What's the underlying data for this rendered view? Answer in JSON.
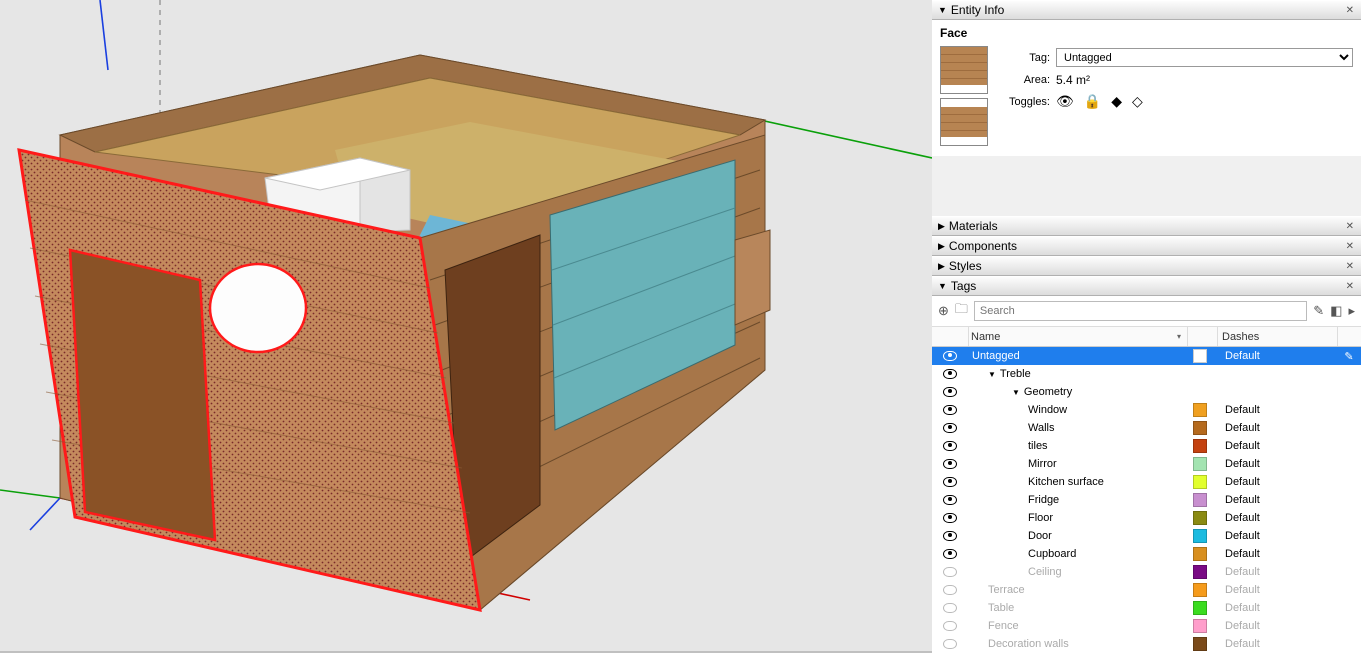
{
  "panels": {
    "entityInfo": {
      "title": "Entity Info",
      "selectionType": "Face",
      "tagLabel": "Tag:",
      "tagValue": "Untagged",
      "areaLabel": "Area:",
      "areaValue": "5.4 m²",
      "togglesLabel": "Toggles:"
    },
    "materials": {
      "title": "Materials"
    },
    "components": {
      "title": "Components"
    },
    "styles": {
      "title": "Styles"
    },
    "tags": {
      "title": "Tags",
      "searchPlaceholder": "Search",
      "columns": {
        "name": "Name",
        "dashes": "Dashes"
      },
      "rows": [
        {
          "vis": true,
          "name": "Untagged",
          "indent": 0,
          "tri": "",
          "swatch": "#ffffff",
          "dash": "Default",
          "selected": true,
          "pencil": true
        },
        {
          "vis": true,
          "name": "Treble",
          "indent": 1,
          "tri": "▼",
          "swatch": "",
          "dash": "",
          "selected": false
        },
        {
          "vis": true,
          "name": "Geometry",
          "indent": 2,
          "tri": "▼",
          "swatch": "",
          "dash": "",
          "selected": false
        },
        {
          "vis": true,
          "name": "Window",
          "indent": 3,
          "tri": "",
          "swatch": "#f0a020",
          "dash": "Default",
          "selected": false
        },
        {
          "vis": true,
          "name": "Walls",
          "indent": 3,
          "tri": "",
          "swatch": "#b56a1e",
          "dash": "Default",
          "selected": false
        },
        {
          "vis": true,
          "name": "tiles",
          "indent": 3,
          "tri": "",
          "swatch": "#c44210",
          "dash": "Default",
          "selected": false
        },
        {
          "vis": true,
          "name": "Mirror",
          "indent": 3,
          "tri": "",
          "swatch": "#a3e4b1",
          "dash": "Default",
          "selected": false
        },
        {
          "vis": true,
          "name": "Kitchen surface",
          "indent": 3,
          "tri": "",
          "swatch": "#e2ff2e",
          "dash": "Default",
          "selected": false
        },
        {
          "vis": true,
          "name": "Fridge",
          "indent": 3,
          "tri": "",
          "swatch": "#c88fcf",
          "dash": "Default",
          "selected": false
        },
        {
          "vis": true,
          "name": "Floor",
          "indent": 3,
          "tri": "",
          "swatch": "#8a8a12",
          "dash": "Default",
          "selected": false
        },
        {
          "vis": true,
          "name": "Door",
          "indent": 3,
          "tri": "",
          "swatch": "#1cbbe0",
          "dash": "Default",
          "selected": false
        },
        {
          "vis": true,
          "name": "Cupboard",
          "indent": 3,
          "tri": "",
          "swatch": "#d88f1f",
          "dash": "Default",
          "selected": false
        },
        {
          "vis": false,
          "name": "Ceiling",
          "indent": 3,
          "tri": "",
          "swatch": "#7a0b85",
          "dash": "Default",
          "selected": false
        },
        {
          "vis": false,
          "name": "Terrace",
          "indent": 1,
          "tri": "",
          "swatch": "#f59b1c",
          "dash": "Default",
          "selected": false
        },
        {
          "vis": false,
          "name": "Table",
          "indent": 1,
          "tri": "",
          "swatch": "#3bdc20",
          "dash": "Default",
          "selected": false
        },
        {
          "vis": false,
          "name": "Fence",
          "indent": 1,
          "tri": "",
          "swatch": "#ff9ecb",
          "dash": "Default",
          "selected": false
        },
        {
          "vis": false,
          "name": "Decoration walls",
          "indent": 1,
          "tri": "",
          "swatch": "#7a4a1a",
          "dash": "Default",
          "selected": false
        }
      ]
    }
  }
}
